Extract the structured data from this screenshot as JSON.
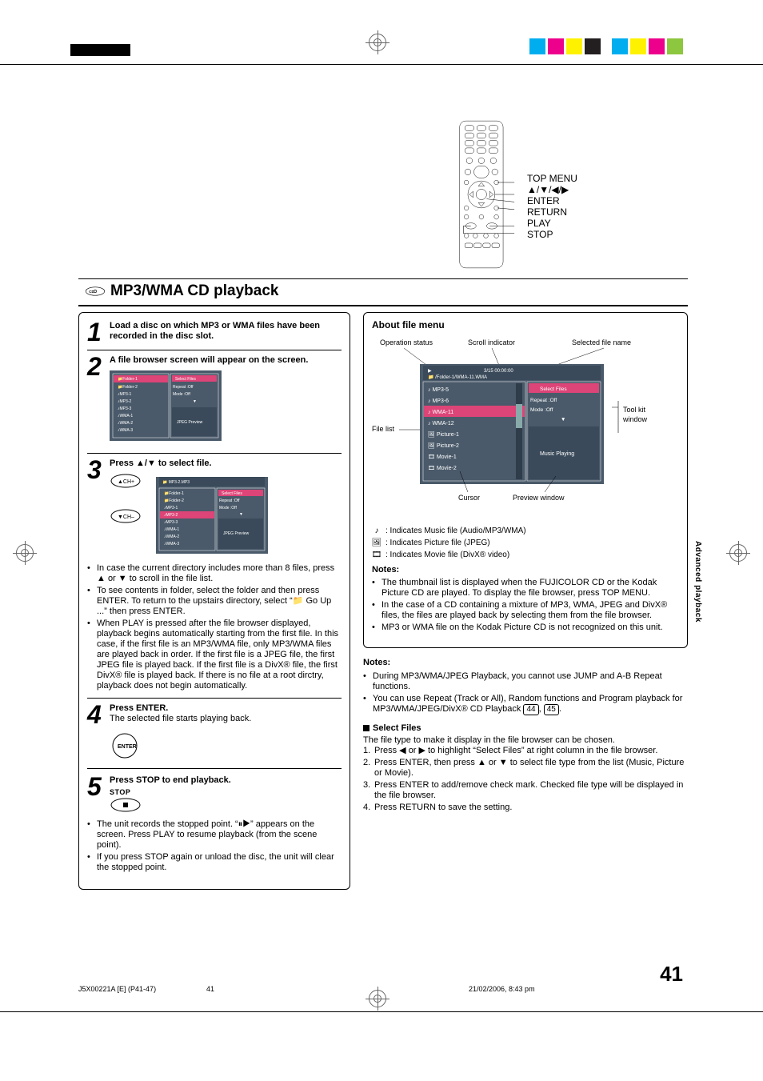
{
  "page_number": "41",
  "footer": {
    "doc": "J5X00221A [E] (P41-47)",
    "page": "41",
    "date": "21/02/2006, 8:43 pm"
  },
  "side_tab": "Advanced playback",
  "remote": {
    "labels": [
      "TOP MENU",
      "▲/▼/◀/▶",
      "ENTER",
      "RETURN",
      "PLAY",
      "STOP"
    ]
  },
  "section_title": "MP3/WMA CD playback",
  "steps": {
    "s1": {
      "n": "1",
      "text": "Load a disc on which MP3 or WMA files have been recorded in the disc slot."
    },
    "s2": {
      "n": "2",
      "text": "A file browser screen will appear on the screen."
    },
    "s3": {
      "n": "3",
      "text": "Press ▲/▼ to select file."
    },
    "s4": {
      "n": "4",
      "lead": "Press ENTER.",
      "plain": "The selected file starts playing back."
    },
    "s5": {
      "n": "5",
      "lead": "Press STOP to end playback."
    }
  },
  "fb_mock_a": {
    "items": [
      "Folder-1",
      "Folder-2",
      "MP3-1",
      "MP3-2",
      "MP3-3",
      "WMA-1",
      "WMA-2",
      "WMA-3"
    ],
    "right": [
      "Select Files",
      "Repeat    :Off",
      "Mode       :Off",
      "▼",
      "",
      "JPEG Preview"
    ]
  },
  "fb_mock_b": {
    "path": " MP3-2.MP3",
    "items": [
      "Folder-1",
      "Folder-2",
      "MP3-1",
      "MP3-2",
      "MP3-3",
      "WMA-1",
      "WMA-2",
      "WMA-3"
    ],
    "right": [
      "Select Files",
      "Repeat    :Off",
      "Mode       :Off",
      "▼",
      "",
      "JPEG Preview"
    ]
  },
  "left_bullets_3": [
    "In case the current directory includes more than 8 files, press ▲ or ▼ to scroll in the file list.",
    "To see contents in folder, select the folder and then press ENTER. To return to the upstairs directory, select “📁 Go Up ...” then press ENTER.",
    "When PLAY is pressed after the file browser displayed, playback begins automatically starting from the first file. In this case, if the first file is an MP3/WMA file, only MP3/WMA files are played back in order. If the first file is a JPEG file, the first JPEG file is played back. If the first file is a DivX® file, the first DivX® file is played back. If there is no file at a root dirctry, playback does not begin automatically."
  ],
  "left_bullets_5": [
    "The unit records the stopped point. “⏸▶” appears on the screen. Press PLAY to resume playback (from the scene point).",
    "If you press STOP again or unload the disc, the unit will clear the stopped point."
  ],
  "stop_label": "STOP",
  "about": {
    "heading": "About file menu",
    "labels": {
      "op": "Operation status",
      "scroll": "Scroll indicator",
      "sel": "Selected file name",
      "flist": "File list",
      "cursor": "Cursor",
      "preview": "Preview window",
      "tool": "Tool kit window"
    },
    "screen": {
      "header": "3/15  00:00:00",
      "path": "📁 /Folder-1/WMA-11.WMA",
      "items": [
        "♪ MP3-5",
        "♪ MP3-6",
        "♪ WMA-11",
        "♪ WMA-12",
        "🖼 Picture-1",
        "🖼 Picture-2",
        "🎞 Movie-1",
        "🎞 Movie-2"
      ],
      "right": [
        "Select Files",
        "Repeat    :Off",
        "Mode       :Off",
        "▼",
        "",
        "Music Playing"
      ]
    },
    "legend": {
      "music": ": Indicates Music file (Audio/MP3/WMA)",
      "picture": ": Indicates Picture file (JPEG)",
      "movie": ": Indicates Movie file (DivX® video)"
    },
    "notes_heading": "Notes:",
    "notes": [
      "The thumbnail list is displayed when the FUJICOLOR CD or the Kodak Picture CD are played. To display the file browser, press TOP MENU.",
      "In the case of a CD containing a mixture of MP3, WMA, JPEG and DivX® files, the files are played back by selecting them from the file browser.",
      "MP3 or WMA file on the Kodak Picture CD is not recognized on this unit."
    ]
  },
  "outer": {
    "notes_heading": "Notes:",
    "notes": [
      "During MP3/WMA/JPEG Playback, you cannot use JUMP and A-B Repeat functions.",
      "You can use Repeat (Track or All), Random functions and Program playback for MP3/WMA/JPEG/DivX® CD Playback"
    ],
    "pg_refs": [
      "44",
      "45"
    ],
    "select_heading": "Select Files",
    "select_intro": "The file type to make it display in the file browser can be chosen.",
    "select_steps": [
      "Press ◀ or ▶ to highlight “Select Files” at right column in the file browser.",
      "Press ENTER, then press ▲ or ▼ to select file type from the list (Music, Picture or Movie).",
      "Press ENTER to add/remove check mark. Checked file type will be displayed in the file browser.",
      "Press RETURN to save the setting."
    ]
  },
  "print_colors": [
    "#00aeef",
    "#ec008c",
    "#fff200",
    "#231f20",
    "   ",
    "#00aeef",
    "#fff200",
    "#ec008c",
    "#8dc63f"
  ]
}
